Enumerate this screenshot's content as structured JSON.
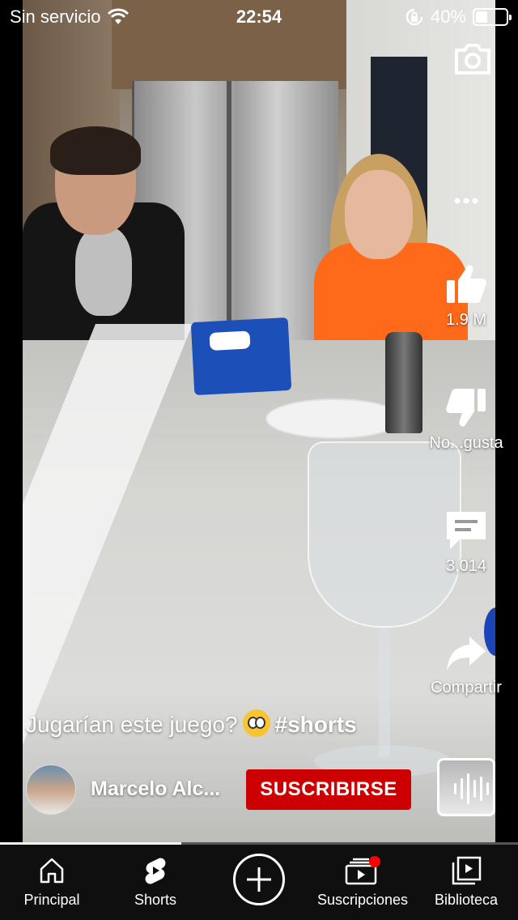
{
  "status_bar": {
    "carrier": "Sin servicio",
    "time": "22:54",
    "battery": "40%",
    "battery_level": 0.4,
    "icons": [
      "wifi-icon",
      "orientation-lock-icon",
      "battery-icon"
    ]
  },
  "actions": {
    "camera_icon": "camera-icon",
    "more_icon": "more-horizontal-icon",
    "like": {
      "icon": "thumbs-up-icon",
      "label": "1.9 M"
    },
    "dislike": {
      "icon": "thumbs-down-icon",
      "label": "No...gusta"
    },
    "comments": {
      "icon": "comment-icon",
      "label": "3,014"
    },
    "share": {
      "icon": "share-icon",
      "label": "Compartir"
    }
  },
  "video": {
    "caption_text": "Jugarían este juego?",
    "caption_emoji": "flushed-face-emoji",
    "hashtag": "#shorts",
    "channel_name": "Marcelo Alc...",
    "subscribe_label": "SUSCRIBIRSE",
    "progress": 0.35
  },
  "bottom_nav": {
    "items": [
      {
        "label": "Principal",
        "icon": "home-icon"
      },
      {
        "label": "Shorts",
        "icon": "shorts-icon"
      },
      {
        "label": "",
        "icon": "create-plus-icon"
      },
      {
        "label": "Suscripciones",
        "icon": "subscriptions-icon"
      },
      {
        "label": "Biblioteca",
        "icon": "library-icon"
      }
    ]
  },
  "colors": {
    "subscribe_red": "#cc0000",
    "nav_background": "#0f0f0f",
    "notification_dot": "#ff0000"
  }
}
